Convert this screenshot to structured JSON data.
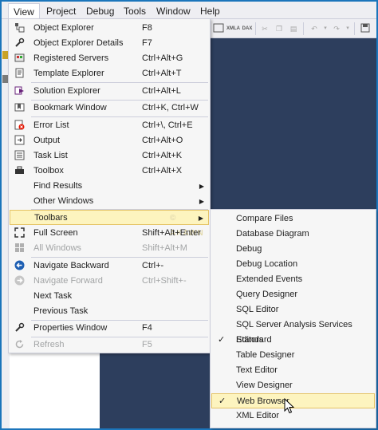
{
  "menubar": {
    "items": [
      "View",
      "Project",
      "Debug",
      "Tools",
      "Window",
      "Help"
    ]
  },
  "view_menu": {
    "items": [
      {
        "label": "Object Explorer",
        "shortcut": "F8",
        "icon": "object-explorer-icon"
      },
      {
        "label": "Object Explorer Details",
        "shortcut": "F7",
        "icon": "wrench-icon"
      },
      {
        "label": "Registered Servers",
        "shortcut": "Ctrl+Alt+G",
        "icon": "registered-servers-icon"
      },
      {
        "label": "Template Explorer",
        "shortcut": "Ctrl+Alt+T",
        "icon": "template-explorer-icon"
      },
      {
        "label": "Solution Explorer",
        "shortcut": "Ctrl+Alt+L",
        "icon": "solution-explorer-icon"
      },
      {
        "label": "Bookmark Window",
        "shortcut": "Ctrl+K, Ctrl+W",
        "icon": "bookmark-icon"
      },
      {
        "label": "Error List",
        "shortcut": "Ctrl+\\, Ctrl+E",
        "icon": "error-list-icon"
      },
      {
        "label": "Output",
        "shortcut": "Ctrl+Alt+O",
        "icon": "output-icon"
      },
      {
        "label": "Task List",
        "shortcut": "Ctrl+Alt+K",
        "icon": "task-list-icon"
      },
      {
        "label": "Toolbox",
        "shortcut": "Ctrl+Alt+X",
        "icon": "toolbox-icon"
      },
      {
        "label": "Find Results",
        "shortcut": "",
        "icon": ""
      },
      {
        "label": "Other Windows",
        "shortcut": "",
        "icon": ""
      },
      {
        "label": "Toolbars",
        "shortcut": "",
        "icon": ""
      },
      {
        "label": "Full Screen",
        "shortcut": "Shift+Alt+Enter",
        "icon": "full-screen-icon"
      },
      {
        "label": "All Windows",
        "shortcut": "Shift+Alt+M",
        "icon": "all-windows-icon"
      },
      {
        "label": "Navigate Backward",
        "shortcut": "Ctrl+-",
        "icon": "navigate-backward-icon"
      },
      {
        "label": "Navigate Forward",
        "shortcut": "Ctrl+Shift+-",
        "icon": "navigate-forward-icon"
      },
      {
        "label": "Next Task",
        "shortcut": "",
        "icon": ""
      },
      {
        "label": "Previous Task",
        "shortcut": "",
        "icon": ""
      },
      {
        "label": "Properties Window",
        "shortcut": "F4",
        "icon": "properties-wrench-icon"
      },
      {
        "label": "Refresh",
        "shortcut": "F5",
        "icon": "refresh-icon"
      }
    ],
    "watermark": "© AKAWN"
  },
  "toolbars_submenu": {
    "items": [
      {
        "label": "Compare Files",
        "checked": false
      },
      {
        "label": "Database Diagram",
        "checked": false
      },
      {
        "label": "Debug",
        "checked": false
      },
      {
        "label": "Debug Location",
        "checked": false
      },
      {
        "label": "Extended Events",
        "checked": false
      },
      {
        "label": "Query Designer",
        "checked": false
      },
      {
        "label": "SQL Editor",
        "checked": false
      },
      {
        "label": "SQL Server Analysis Services Editors",
        "checked": false
      },
      {
        "label": "Standard",
        "checked": true
      },
      {
        "label": "Table Designer",
        "checked": false
      },
      {
        "label": "Text Editor",
        "checked": false
      },
      {
        "label": "View Designer",
        "checked": false
      },
      {
        "label": "Web Browser",
        "checked": true
      },
      {
        "label": "XML Editor",
        "checked": false
      }
    ],
    "check_glyph": "✓"
  },
  "toolbar": {
    "xmla_label": "XMLA",
    "dax_label": "DAX"
  },
  "colors": {
    "accent": "#1b75bb",
    "highlight": "#fdf4bf",
    "editor_bg": "#2d3e5d"
  }
}
